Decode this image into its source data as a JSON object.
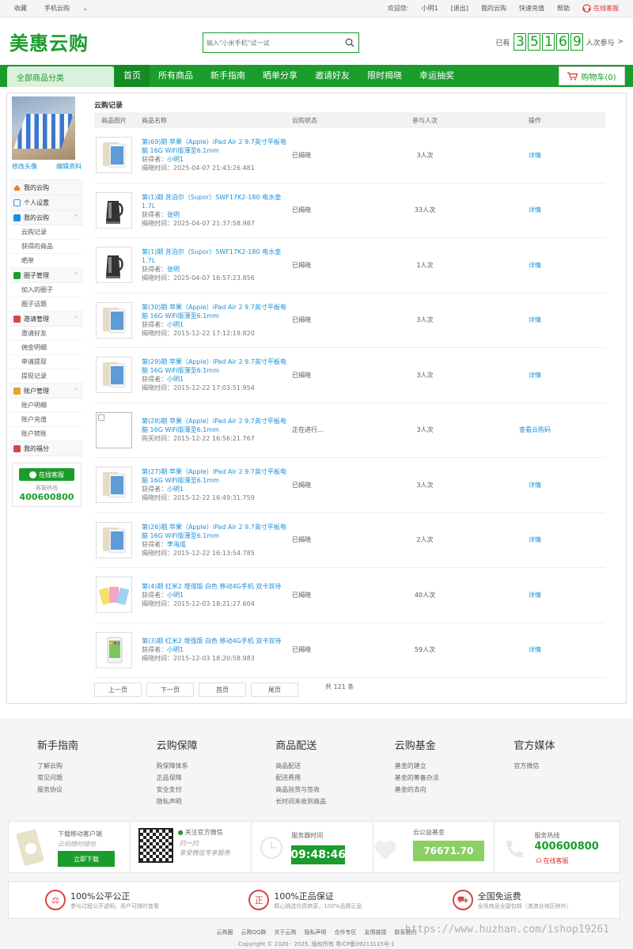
{
  "topbar": {
    "favorite": "收藏",
    "mobile": "手机云购",
    "welcome": "欢迎您:",
    "username": "小明1",
    "logout": "[退出]",
    "my_cloud": "我的云购",
    "recharge": "快速充值",
    "help": "帮助",
    "online_service": "在线客服"
  },
  "header": {
    "logo": "美惠云购",
    "search_placeholder": "输入\"小米手机\"试一试",
    "counter_prefix": "已有",
    "counter_digits": [
      "3",
      "5",
      "1",
      "6",
      "9"
    ],
    "counter_suffix": "人次参与",
    "counter_arrow": ">"
  },
  "nav": {
    "category": "全部商品分类",
    "items": [
      "首页",
      "所有商品",
      "新手指南",
      "晒单分享",
      "邀请好友",
      "限时揭晓",
      "幸运抽奖"
    ],
    "cart": "购物车(0)"
  },
  "sidebar": {
    "change_avatar": "修改头像",
    "edit_profile": "编辑资料",
    "menu": {
      "my_cloud": "我的云购",
      "personal": "个人设置",
      "my_cloud_group": "我的云购",
      "records": "云购记录",
      "won": "获得的商品",
      "share": "晒单",
      "circle": "圈子管理",
      "joined": "加入的圈子",
      "topics": "圈子话题",
      "invite": "邀请管理",
      "invite_friends": "邀请好友",
      "commission": "佣金明细",
      "withdraw_apply": "申请提现",
      "withdraw_records": "提现记录",
      "account": "账户管理",
      "account_detail": "账户明细",
      "account_recharge": "账户充值",
      "account_transfer": "账户转账",
      "points": "我的福分"
    },
    "service_button": "在线客服",
    "hotline_label": "客服热线",
    "hotline": "400600800"
  },
  "content": {
    "title": "云购记录",
    "headers": [
      "商品图片",
      "商品名称",
      "云购状态",
      "参与人次",
      "操作"
    ],
    "rows": [
      {
        "name": "第(69)期 苹果（Apple）iPad Air 2 9.7英寸平板电脑 16G WiFi版薄至6.1mm",
        "winner_label": "获得者：",
        "winner": "小明1",
        "time_label": "揭晓时间：",
        "time": "2025-04-07 21:43:26.481",
        "status": "已揭晓",
        "count": "3人次",
        "action": "详情",
        "img": "ipad"
      },
      {
        "name": "第(1)期 苏泊尔（Supor）SWF17K2-180 电水壶 1.7L",
        "winner_label": "获得者：",
        "winner": "张明",
        "time_label": "揭晓时间：",
        "time": "2025-04-07 21:37:58.987",
        "status": "已揭晓",
        "count": "33人次",
        "action": "详情",
        "img": "kettle"
      },
      {
        "name": "第(1)期 苏泊尔（Supor）SWF17K2-180 电水壶 1.7L",
        "winner_label": "获得者：",
        "winner": "张明",
        "time_label": "揭晓时间：",
        "time": "2025-04-07 16:57:23.856",
        "status": "已揭晓",
        "count": "1人次",
        "action": "详情",
        "img": "kettle"
      },
      {
        "name": "第(30)期 苹果（Apple）iPad Air 2 9.7英寸平板电脑 16G WiFi版薄至6.1mm",
        "winner_label": "获得者：",
        "winner": "小明1",
        "time_label": "揭晓时间：",
        "time": "2015-12-22 17:12:19.820",
        "status": "已揭晓",
        "count": "3人次",
        "action": "详情",
        "img": "ipad"
      },
      {
        "name": "第(29)期 苹果（Apple）iPad Air 2 9.7英寸平板电脑 16G WiFi版薄至6.1mm",
        "winner_label": "获得者：",
        "winner": "小明1",
        "time_label": "揭晓时间：",
        "time": "2015-12-22 17:03:51.954",
        "status": "已揭晓",
        "count": "3人次",
        "action": "详情",
        "img": "ipad"
      },
      {
        "name": "第(28)期 苹果（Apple）iPad Air 2 9.7英寸平板电脑 16G WiFi版薄至6.1mm",
        "winner_label": "",
        "winner": "",
        "time_label": "购买时间：",
        "time": "2015-12-22 16:56:21.767",
        "status": "正在进行...",
        "count": "3人次",
        "action": "查看云购码",
        "img": "broken"
      },
      {
        "name": "第(27)期 苹果（Apple）iPad Air 2 9.7英寸平板电脑 16G WiFi版薄至6.1mm",
        "winner_label": "获得者：",
        "winner": "小明1",
        "time_label": "揭晓时间：",
        "time": "2015-12-22 16:49:31.759",
        "status": "已揭晓",
        "count": "3人次",
        "action": "详情",
        "img": "ipad"
      },
      {
        "name": "第(26)期 苹果（Apple）iPad Air 2 9.7英寸平板电脑 16G WiFi版薄至6.1mm",
        "winner_label": "获得者：",
        "winner": "李海成",
        "time_label": "揭晓时间：",
        "time": "2015-12-22 16:13:54.785",
        "status": "已揭晓",
        "count": "2人次",
        "action": "详情",
        "img": "ipad"
      },
      {
        "name": "第(4)期 红米2 增强版 白色 移动4G手机 双卡双待",
        "winner_label": "获得者：",
        "winner": "小明1",
        "time_label": "揭晓时间：",
        "time": "2015-12-03 18:21:27.604",
        "status": "已揭晓",
        "count": "40人次",
        "action": "详情",
        "img": "phones"
      },
      {
        "name": "第(3)期 红米2 增强版 白色 移动4G手机 双卡双待",
        "winner_label": "获得者：",
        "winner": "小明1",
        "time_label": "揭晓时间：",
        "time": "2015-12-03 18:20:58.983",
        "status": "已揭晓",
        "count": "59人次",
        "action": "详情",
        "img": "phone"
      }
    ],
    "pager": {
      "prev": "上一页",
      "next": "下一页",
      "first": "首页",
      "last": "尾页",
      "total": "共 121 条"
    }
  },
  "footer": {
    "cols": [
      {
        "title": "新手指南",
        "links": [
          "了解云购",
          "常见问题",
          "服务协议"
        ]
      },
      {
        "title": "云购保障",
        "links": [
          "购保障体系",
          "正品保障",
          "安全支付",
          "隐私声明"
        ]
      },
      {
        "title": "商品配送",
        "links": [
          "商品配送",
          "配送费用",
          "商品验货与签收",
          "长时间未收到商品"
        ]
      },
      {
        "title": "云购基金",
        "links": [
          "基金的建立",
          "基金的筹备办法",
          "基金的去向"
        ]
      },
      {
        "title": "官方媒体",
        "links": [
          "官方微信"
        ]
      }
    ],
    "app": {
      "label": "下载移动客户端",
      "slogan": "云购随时随地",
      "button": "立即下载"
    },
    "wechat": {
      "label": "关注官方微信",
      "hint1": "扫一扫",
      "hint2": "享受微信专享服务"
    },
    "server_time": {
      "label": "服务器时间",
      "value": "09:48:46"
    },
    "fund": {
      "label": "云公益基金",
      "value": "76671.70"
    },
    "hotline": {
      "label": "服务热线",
      "value": "400600800",
      "service": "在线客服"
    },
    "badges": [
      {
        "title": "100%公平公正",
        "desc": "参与过程公开透明，用户可随时查看"
      },
      {
        "title": "100%正品保证",
        "desc": "精心挑选优质商家，100%品牌正品"
      },
      {
        "title": "全国免运费",
        "desc": "全场商品全国包邮（港澳台地区除外）"
      }
    ],
    "links": [
      "云购圈",
      "云购QQ群",
      "关于云购",
      "隐私声明",
      "合作专区",
      "友情链接",
      "联系我们"
    ],
    "copyright": "Copyright © 2020 - 2025, 版权所有 粤ICP备09213115号-1",
    "watermark": "https://www.huzhan.com/ishop19261"
  },
  "colors": {
    "brand": "#1a9d2b",
    "link": "#1a8fd9",
    "alert": "#d33"
  }
}
